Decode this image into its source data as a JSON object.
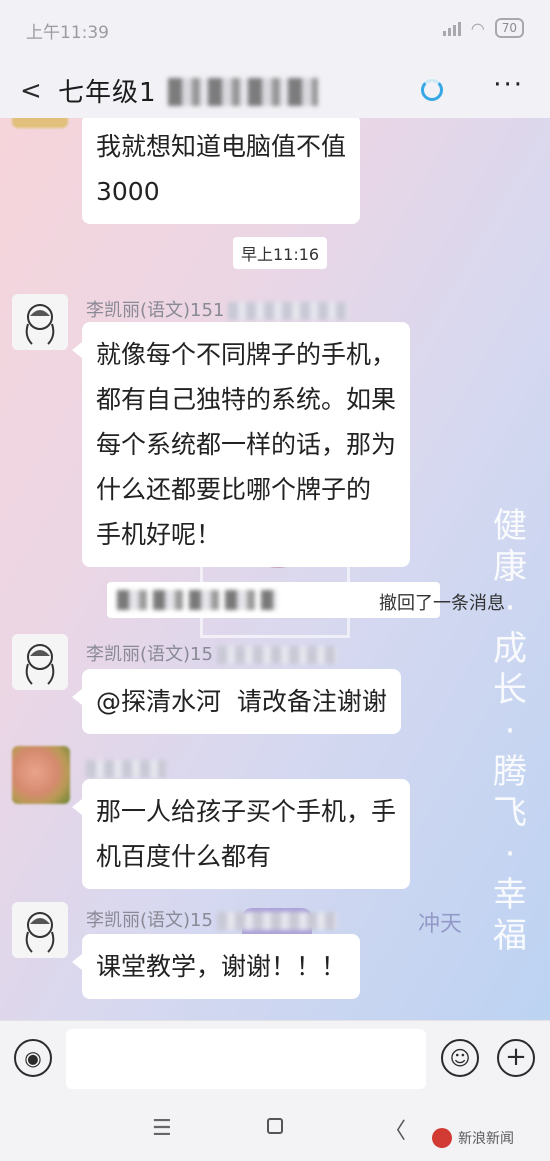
{
  "status_bar": {
    "time": "上午11:39",
    "battery": "70"
  },
  "header": {
    "title": "七年级1"
  },
  "messages": {
    "m1": {
      "text": "我就想知道电脑值不值\n3000"
    },
    "time_chip": "早上11:16",
    "m2": {
      "sender": "李凯丽(语文)151",
      "text": "就像每个不同牌子的手机，\n都有自己独特的系统。如果\n每个系统都一样的话，那为\n什么还都要比哪个牌子的\n手机好呢！"
    },
    "recall": "撤回了一条消息",
    "m3": {
      "sender": "李凯丽(语文)15",
      "text": "@探清水河  请改备注谢谢"
    },
    "m4": {
      "text": "那一人给孩子买个手机，手\n机百度什么都有"
    },
    "m5": {
      "sender": "李凯丽(语文)15",
      "text": "课堂教学，谢谢！！！"
    }
  },
  "watermark": {
    "vertical": "健康·成长·腾飞·幸福",
    "bottom": "冲天"
  },
  "input_bar": {
    "placeholder": ""
  },
  "nav": {
    "menu": "☰",
    "back": "〈"
  },
  "brand": {
    "text": "新浪新闻"
  },
  "colors": {
    "bubble": "#ffffff",
    "accent_loading": "#35a8e5"
  }
}
